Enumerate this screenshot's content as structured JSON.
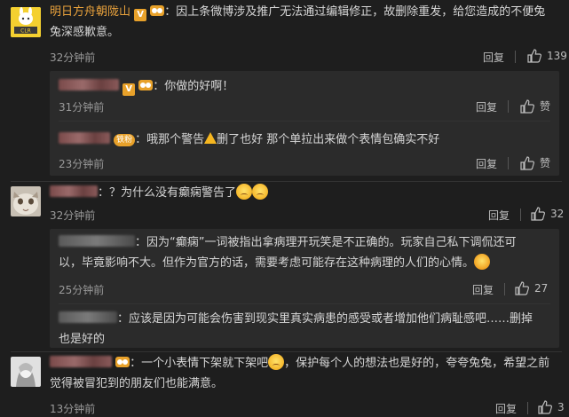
{
  "comments": [
    {
      "username": "明日方舟朝陇山",
      "text_line1": "：因上条微博涉及推广无法通过编辑修正，故删除重发，给您造成的不便兔",
      "text_line2": "兔深感歉意。",
      "time": "32分钟前",
      "reply_label": "回复",
      "likes": "139",
      "replies": [
        {
          "text": "：你做的好啊！",
          "time": "31分钟前",
          "reply_label": "回复",
          "likes": "赞"
        },
        {
          "fan_badge": "铁粉",
          "text_a": "：哦那个警告",
          "text_b": "删了也好 那个单拉出来做个表情包确实不好",
          "time": "23分钟前",
          "reply_label": "回复",
          "likes": "赞"
        }
      ]
    },
    {
      "text": "：？为什么没有癫痫警告了",
      "time": "32分钟前",
      "reply_label": "回复",
      "likes": "32",
      "replies": [
        {
          "text_line1": "：因为“癫痫”一词被指出拿病理开玩笑是不正确的。玩家自己私下调侃还可",
          "text_line2": "以，毕竟影响不大。但作为官方的话，需要考虑可能存在这种病理的人们的心情。",
          "time": "25分钟前",
          "reply_label": "回复",
          "likes": "27"
        },
        {
          "text_line1": "：应该是因为可能会伤害到现实里真实病患的感受或者增加他们病耻感吧……删掉",
          "text_line2": "也是好的"
        }
      ]
    },
    {
      "text_line1": "：一个小表情下架就下架吧",
      "text_line1b": "，保护每个人的想法也是好的，夸夸兔兔，希望之前",
      "text_line2": "觉得被冒犯到的朋友们也能满意。",
      "time": "13分钟前",
      "reply_label": "回复",
      "likes": "3"
    }
  ],
  "colors": {
    "background": "#1e1e1e",
    "reply_background": "#2b2b2b",
    "username": "#e9a23c"
  },
  "icons": [
    "thumb-up-icon",
    "verified-badge-icon",
    "vip-icon",
    "warning-icon",
    "emoji-icon"
  ]
}
